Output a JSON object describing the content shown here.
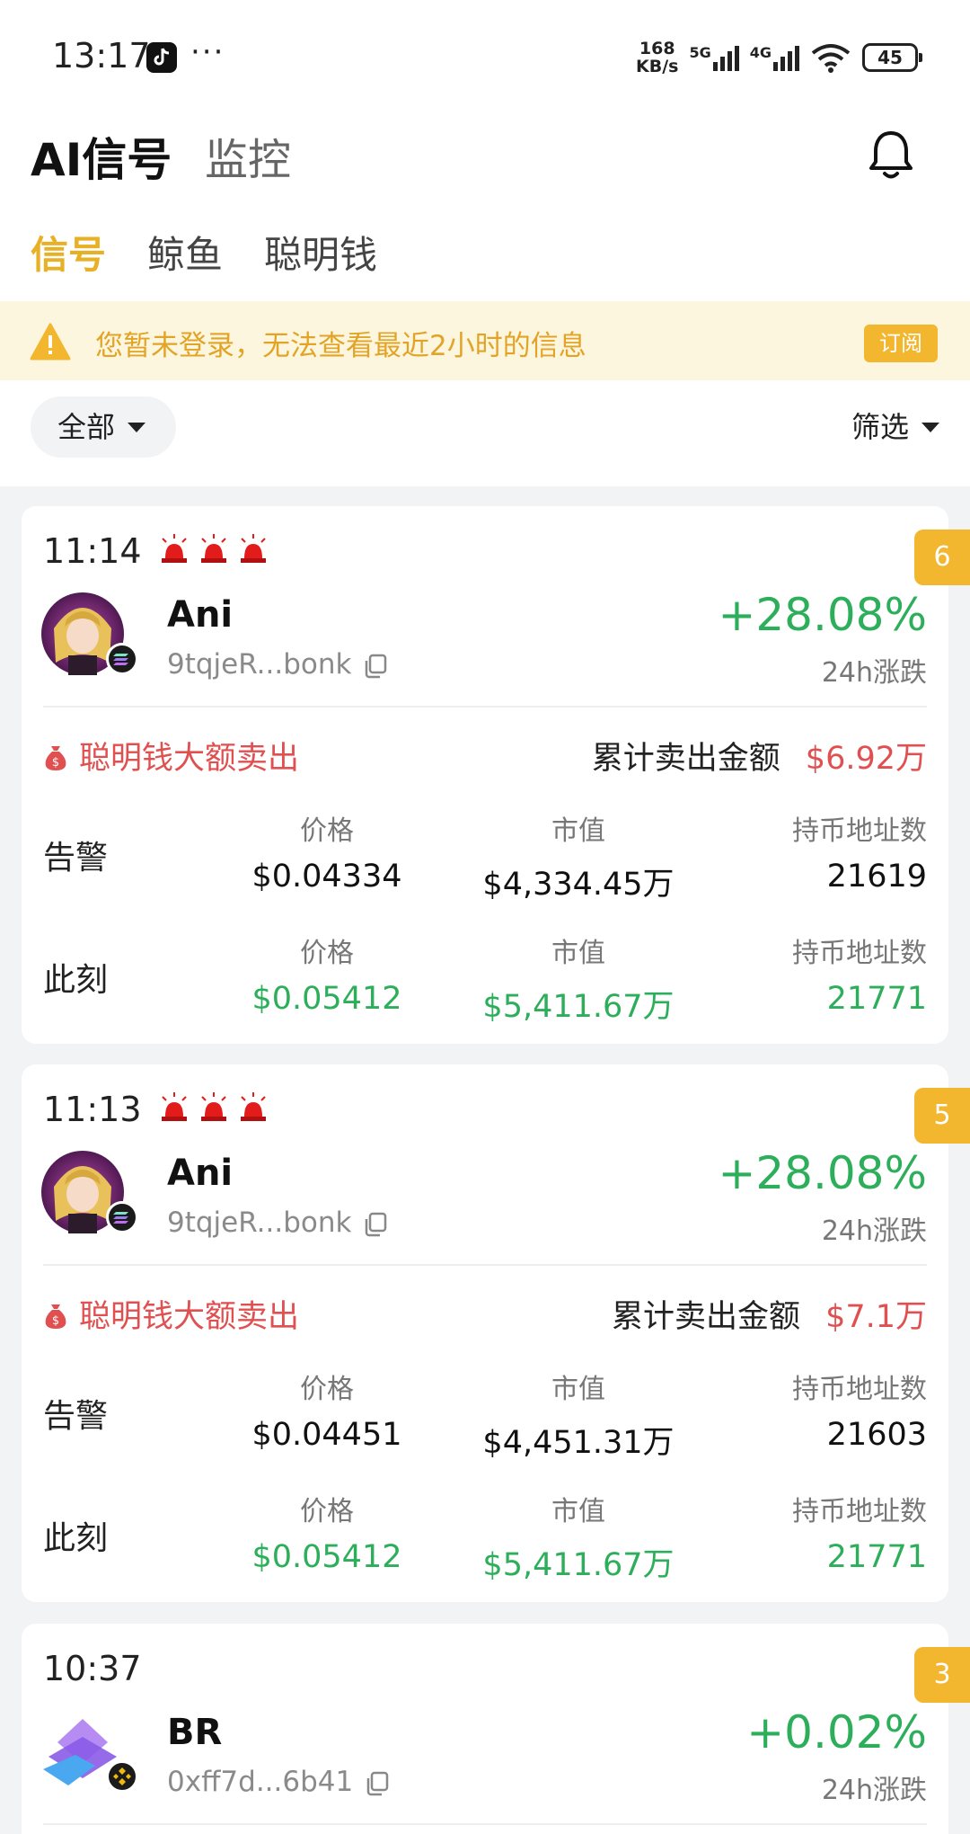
{
  "status_bar": {
    "time": "13:17",
    "dots": "···",
    "speed_value": "168",
    "speed_unit": "KB/s",
    "net1": "5G",
    "net2": "4G",
    "battery": "45"
  },
  "header": {
    "title": "AI信号",
    "subtitle": "监控",
    "tabs": [
      {
        "label": "信号",
        "active": true
      },
      {
        "label": "鲸鱼",
        "active": false
      },
      {
        "label": "聪明钱",
        "active": false
      }
    ]
  },
  "banner": {
    "text": "您暂未登录，无法查看最近2小时的信息",
    "button": "订阅"
  },
  "filters": {
    "scope": "全部",
    "filter": "筛选"
  },
  "colors": {
    "accent": "#e8b024",
    "positive": "#2cae5a",
    "negative": "#e05050",
    "badge": "#f2b62f"
  },
  "cards": [
    {
      "time": "11:14",
      "badge": "6",
      "name": "Ani",
      "address": "9tqjeR...bonk",
      "change": "+28.08%",
      "change_label": "24h涨跌",
      "alert_type": "聪明钱大额卖出",
      "cum_label": "累计卖出金额",
      "cum_value": "$6.92万",
      "alert_row": {
        "label": "告警",
        "price_h": "价格",
        "price": "$0.04334",
        "mcap_h": "市值",
        "mcap": "$4,334.45万",
        "holders_h": "持币地址数",
        "holders": "21619"
      },
      "now_row": {
        "label": "此刻",
        "price_h": "价格",
        "price": "$0.05412",
        "mcap_h": "市值",
        "mcap": "$5,411.67万",
        "holders_h": "持币地址数",
        "holders": "21771"
      }
    },
    {
      "time": "11:13",
      "badge": "5",
      "name": "Ani",
      "address": "9tqjeR...bonk",
      "change": "+28.08%",
      "change_label": "24h涨跌",
      "alert_type": "聪明钱大额卖出",
      "cum_label": "累计卖出金额",
      "cum_value": "$7.1万",
      "alert_row": {
        "label": "告警",
        "price_h": "价格",
        "price": "$0.04451",
        "mcap_h": "市值",
        "mcap": "$4,451.31万",
        "holders_h": "持币地址数",
        "holders": "21603"
      },
      "now_row": {
        "label": "此刻",
        "price_h": "价格",
        "price": "$0.05412",
        "mcap_h": "市值",
        "mcap": "$5,411.67万",
        "holders_h": "持币地址数",
        "holders": "21771"
      }
    },
    {
      "time": "10:37",
      "badge": "3",
      "name": "BR",
      "address": "0xff7d...6b41",
      "change": "+0.02%",
      "change_label": "24h涨跌"
    }
  ]
}
